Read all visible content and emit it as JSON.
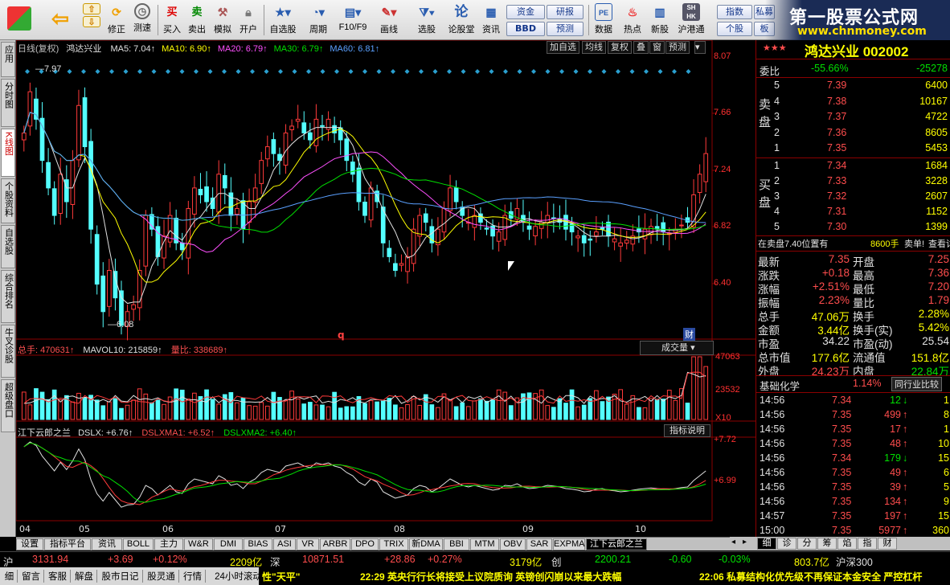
{
  "toolbar": {
    "buttons": [
      "修正",
      "测速",
      "买入",
      "卖出",
      "模拟",
      "开户",
      "自选股",
      "周期",
      "F10/F9",
      "画线",
      "选股",
      "论股堂",
      "资讯",
      "数据",
      "热点",
      "新股",
      "沪港通",
      "个股"
    ],
    "pills": [
      "资金",
      "BBD",
      "研报",
      "预测",
      "指数",
      "私募",
      "板"
    ]
  },
  "brand": {
    "title": "第一股票公式网",
    "url": "www.chnmoney.com"
  },
  "side_tabs": [
    "应用",
    "分时图",
    "K线图",
    "个股资料",
    "自选股",
    "综合排名",
    "牛叉诊股",
    "超级盘口"
  ],
  "chart": {
    "period": "日线(复权)",
    "stock": "鸿达兴业",
    "ma": [
      {
        "label": "MA5: 7.04↑",
        "color": "#e0e0e0"
      },
      {
        "label": "MA10: 6.90↑",
        "color": "#ffff00"
      },
      {
        "label": "MA20: 6.79↑",
        "color": "#ff50ff"
      },
      {
        "label": "MA30: 6.79↑",
        "color": "#00e000"
      },
      {
        "label": "MA60: 6.81↑",
        "color": "#5aa0ff"
      }
    ],
    "menu": [
      "加自选",
      "均线",
      "复权",
      "叠",
      "窗",
      "预测"
    ],
    "price_axis": [
      "8.07",
      "7.66",
      "7.24",
      "6.82",
      "6.40"
    ],
    "high_mark": "7.97",
    "low_mark": "6.08",
    "q_marker": "q",
    "fin_marker": "财",
    "vol_header": {
      "total": "总手: 470631↑",
      "mavol": "MAVOL10: 215859↑",
      "ratio": "量比: 338689↑"
    },
    "vol_dropdown": "成交量",
    "vol_axis": [
      "47063",
      "23532",
      "X10"
    ],
    "ind_header": {
      "name": "江下云郎之兰",
      "dslx": "DSLX: +6.76↑",
      "ma1": "DSLXMA1: +6.52↑",
      "ma2": "DSLXMA2: +6.40↑"
    },
    "ind_help": "指标说明",
    "ind_axis": [
      "+7.72",
      "+6.99"
    ],
    "x_axis": [
      "04",
      "05",
      "06",
      "07",
      "08",
      "09",
      "10"
    ]
  },
  "chart_data": {
    "type": "candlestick",
    "ylim": [
      6.0,
      8.07
    ],
    "closes": [
      7.5,
      7.8,
      7.6,
      7.3,
      7.1,
      6.9,
      7.2,
      7.0,
      7.3,
      7.7,
      7.4,
      6.8,
      6.4,
      6.2,
      6.5,
      6.3,
      6.1,
      6.2,
      6.25,
      6.5,
      6.9,
      6.8,
      6.6,
      6.75,
      6.9,
      6.7,
      6.65,
      6.95,
      7.1,
      7.05,
      7.0,
      6.95,
      7.2,
      7.1,
      6.9,
      6.95,
      6.8,
      7.0,
      7.1,
      7.3,
      7.4,
      7.35,
      7.3,
      7.5,
      7.55,
      7.6,
      7.5,
      7.45,
      7.6,
      7.55,
      7.6,
      7.5,
      7.45,
      7.3,
      7.2,
      7.0,
      6.9,
      7.1,
      7.0,
      6.7,
      6.6,
      6.5,
      6.55,
      6.6,
      6.8,
      6.9,
      6.85,
      6.7,
      6.8,
      6.95,
      7.1,
      7.0,
      6.9,
      6.85,
      6.9,
      6.85,
      6.8,
      6.75,
      6.78,
      6.9,
      6.88,
      6.95,
      6.85,
      6.8,
      6.82,
      6.85,
      6.9,
      6.88,
      6.85,
      6.8,
      6.78,
      6.75,
      6.7,
      6.72,
      6.78,
      6.8,
      6.75,
      6.73,
      6.7,
      6.72,
      6.75,
      6.78,
      6.8,
      6.82,
      6.8,
      6.78,
      6.77,
      6.8,
      6.83,
      6.85,
      7.05,
      7.2,
      7.35
    ]
  },
  "quote": {
    "stars": "★★★",
    "title": "鸿达兴业 002002",
    "weibi_label": "委比",
    "weibi_pct": "-55.66%",
    "weibi_val": "-25278",
    "sell": [
      {
        "n": "5",
        "p": "7.39",
        "v": "6400"
      },
      {
        "n": "4",
        "p": "7.38",
        "v": "10167"
      },
      {
        "n": "3",
        "p": "7.37",
        "v": "4722"
      },
      {
        "n": "2",
        "p": "7.36",
        "v": "8605"
      },
      {
        "n": "1",
        "p": "7.35",
        "v": "5453"
      }
    ],
    "buy": [
      {
        "n": "1",
        "p": "7.34",
        "v": "1684"
      },
      {
        "n": "2",
        "p": "7.33",
        "v": "3228"
      },
      {
        "n": "3",
        "p": "7.32",
        "v": "2607"
      },
      {
        "n": "4",
        "p": "7.31",
        "v": "1152"
      },
      {
        "n": "5",
        "p": "7.30",
        "v": "1399"
      }
    ],
    "sell_label": "卖盘",
    "buy_label": "买盘",
    "order_note": {
      "a": "在卖盘7.40位置有",
      "b": "8600手",
      "c": "卖单!",
      "d": "查看详细"
    },
    "stats": [
      {
        "l1": "最新",
        "v1": "7.35",
        "c1": "red",
        "l2": "开盘",
        "v2": "7.25",
        "c2": "red"
      },
      {
        "l1": "涨跌",
        "v1": "+0.18",
        "c1": "red",
        "l2": "最高",
        "v2": "7.36",
        "c2": "red"
      },
      {
        "l1": "涨幅",
        "v1": "+2.51%",
        "c1": "red",
        "l2": "最低",
        "v2": "7.20",
        "c2": "red"
      },
      {
        "l1": "振幅",
        "v1": "2.23%",
        "c1": "red",
        "l2": "量比",
        "v2": "1.79",
        "c2": "red"
      },
      {
        "l1": "总手",
        "v1": "47.06万",
        "c1": "yel",
        "l2": "换手",
        "v2": "2.28%",
        "c2": "yel"
      },
      {
        "l1": "金额",
        "v1": "3.44亿",
        "c1": "yel",
        "l2": "换手(实)",
        "v2": "5.42%",
        "c2": "yel"
      },
      {
        "l1": "市盈",
        "v1": "34.22",
        "c1": "wht",
        "l2": "市盈(动)",
        "v2": "25.54",
        "c2": "wht"
      },
      {
        "l1": "总市值",
        "v1": "177.6亿",
        "c1": "yel",
        "l2": "流通值",
        "v2": "151.8亿",
        "c2": "yel"
      },
      {
        "l1": "外盘",
        "v1": "24.23万",
        "c1": "red",
        "l2": "内盘",
        "v2": "22.84万",
        "c2": "grn"
      }
    ],
    "sector": {
      "name": "基础化学",
      "pct": "1.14%",
      "button": "同行业比较"
    },
    "ticks": [
      {
        "t": "14:56",
        "p": "7.34",
        "v": "12",
        "d": "↓",
        "dc": "grn",
        "x": "1"
      },
      {
        "t": "14:56",
        "p": "7.35",
        "v": "499",
        "d": "↑",
        "dc": "red",
        "x": "8"
      },
      {
        "t": "14:56",
        "p": "7.35",
        "v": "17",
        "d": "↑",
        "dc": "red",
        "x": "1"
      },
      {
        "t": "14:56",
        "p": "7.35",
        "v": "48",
        "d": "↑",
        "dc": "red",
        "x": "10"
      },
      {
        "t": "14:56",
        "p": "7.34",
        "v": "179",
        "d": "↓",
        "dc": "grn",
        "x": "15"
      },
      {
        "t": "14:56",
        "p": "7.35",
        "v": "49",
        "d": "↑",
        "dc": "red",
        "x": "6"
      },
      {
        "t": "14:56",
        "p": "7.35",
        "v": "39",
        "d": "↑",
        "dc": "red",
        "x": "5"
      },
      {
        "t": "14:56",
        "p": "7.35",
        "v": "134",
        "d": "↑",
        "dc": "red",
        "x": "9"
      },
      {
        "t": "14:57",
        "p": "7.35",
        "v": "197",
        "d": "↑",
        "dc": "red",
        "x": "15"
      },
      {
        "t": "15:00",
        "p": "7.35",
        "v": "5977",
        "d": "↑",
        "dc": "red",
        "x": "360"
      }
    ],
    "detail_tabs": [
      "细",
      "诊",
      "分",
      "筹",
      "焰",
      "指",
      "财"
    ]
  },
  "bottom_tabs": [
    "设置",
    "指标平台",
    "资讯",
    "BOLL",
    "主力",
    "W&R",
    "DMI",
    "BIAS",
    "ASI",
    "VR",
    "ARBR",
    "DPO",
    "TRIX",
    "新DMA",
    "BBI",
    "MTM",
    "OBV",
    "SAR",
    "EXPMA",
    "江下云郎之兰"
  ],
  "status1": {
    "sh_label": "沪",
    "sh_idx": "3131.94",
    "sh_chg": "+3.69",
    "sh_pct": "+0.12%",
    "sh_amt": "2209亿",
    "sz_label": "深",
    "sz_idx": "10871.51",
    "sz_chg": "+28.86",
    "sz_pct": "+0.27%",
    "sz_amt": "3179亿",
    "cy_label": "创",
    "cy_idx": "2200.21",
    "cy_chg": "-0.60",
    "cy_pct": "-0.03%",
    "cy_amt": "803.7亿",
    "hs_label": "沪深300"
  },
  "status2": {
    "items": [
      "细",
      "留言",
      "客服",
      "解盘",
      "股市日记",
      "股灵通",
      "行情",
      "24小时滚动"
    ],
    "tag": "性\"天平\"",
    "news1": "22:29 英央行行长将接受上议院质询 英镑创闪崩以来最大跌幅",
    "news2": "22:06 私募结构化优先级不再保证本金安全 严控杠杆"
  }
}
